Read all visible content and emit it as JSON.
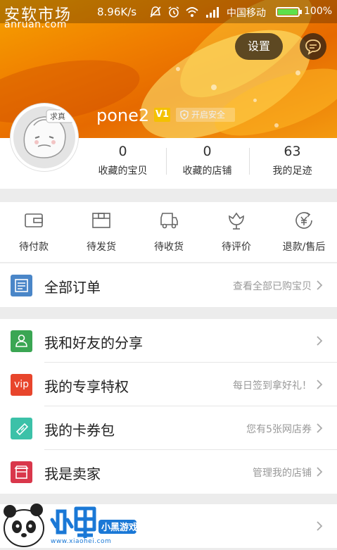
{
  "status_bar": {
    "watermark_brand": "安软市场",
    "speed": "8.96K/s",
    "carrier": "中国移动",
    "battery_percent": 100,
    "battery_text": "100%",
    "watermark_url": "anruan.com"
  },
  "header": {
    "settings_label": "设置",
    "username": "pone2",
    "vip_badge": "V1",
    "security_label": "开启安全",
    "avatar_tag": "求真"
  },
  "stats": [
    {
      "value": "0",
      "label": "收藏的宝贝"
    },
    {
      "value": "0",
      "label": "收藏的店铺"
    },
    {
      "value": "63",
      "label": "我的足迹"
    }
  ],
  "orders": [
    {
      "label": "待付款",
      "icon": "wallet-icon"
    },
    {
      "label": "待发货",
      "icon": "package-icon"
    },
    {
      "label": "待收货",
      "icon": "truck-icon"
    },
    {
      "label": "待评价",
      "icon": "flower-icon"
    },
    {
      "label": "退款/售后",
      "icon": "refund-icon"
    }
  ],
  "all_orders": {
    "title": "全部订单",
    "hint": "查看全部已购宝贝",
    "icon": "order-list-icon",
    "color": "#4a86c8"
  },
  "menu": [
    {
      "title": "我和好友的分享",
      "hint": "",
      "icon": "share-friends-icon",
      "color": "#3aa653"
    },
    {
      "title": "我的专享特权",
      "hint": "每日签到拿好礼！",
      "icon": "vip-icon",
      "icon_text": "vip",
      "color": "#e8452c"
    },
    {
      "title": "我的卡券包",
      "hint": "您有5张网店券",
      "icon": "coupon-icon",
      "color": "#3cc1a8"
    },
    {
      "title": "我是卖家",
      "hint": "管理我的店铺",
      "icon": "shop-icon",
      "color": "#d9374b"
    }
  ],
  "partial_row": {
    "title": "",
    "hint": ""
  },
  "watermark_logo": {
    "site": "www.xiaohei.com",
    "brand": "小黑游戏"
  },
  "colors": {
    "header_orange": "#f08a00",
    "accent_text": "#333333",
    "hint_text": "#999999"
  }
}
